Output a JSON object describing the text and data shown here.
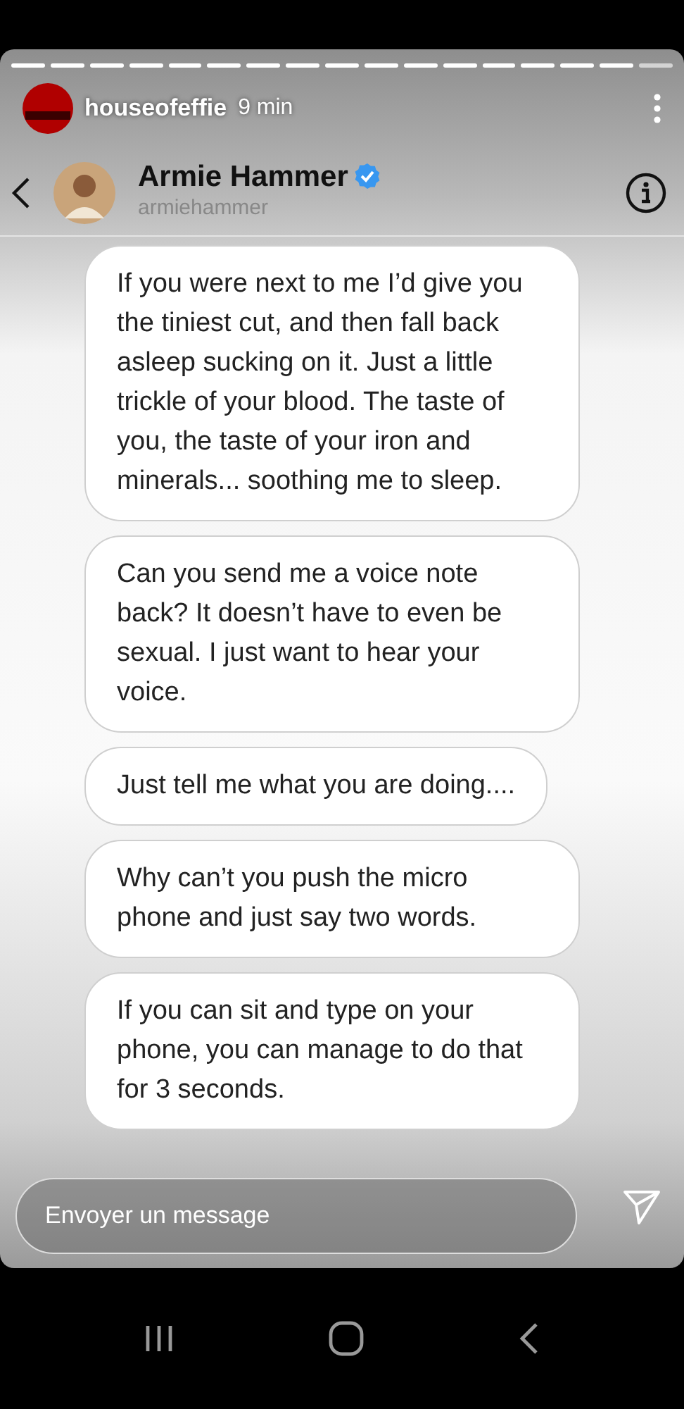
{
  "story": {
    "username": "houseofeffie",
    "time": "9 min"
  },
  "chat": {
    "name": "Armie Hammer",
    "verified": true,
    "handle": "armiehammer"
  },
  "messages": [
    {
      "text": "If you were next to me I’d give you the tiniest cut, and then fall back asleep sucking on it. Just a little trickle of your blood. The taste of you, the taste of your iron and minerals... soothing me to sleep."
    },
    {
      "text": "Can you send me a voice note back? It doesn’t have to even be sexual. I just want to hear your voice."
    },
    {
      "text": "Just tell me what you are doing...."
    },
    {
      "text": "Why can’t you push the micro phone and just say two words."
    },
    {
      "text": "If you can sit and type on your phone, you can manage to do that for 3 seconds."
    }
  ],
  "reply": {
    "placeholder": "Envoyer un message"
  }
}
